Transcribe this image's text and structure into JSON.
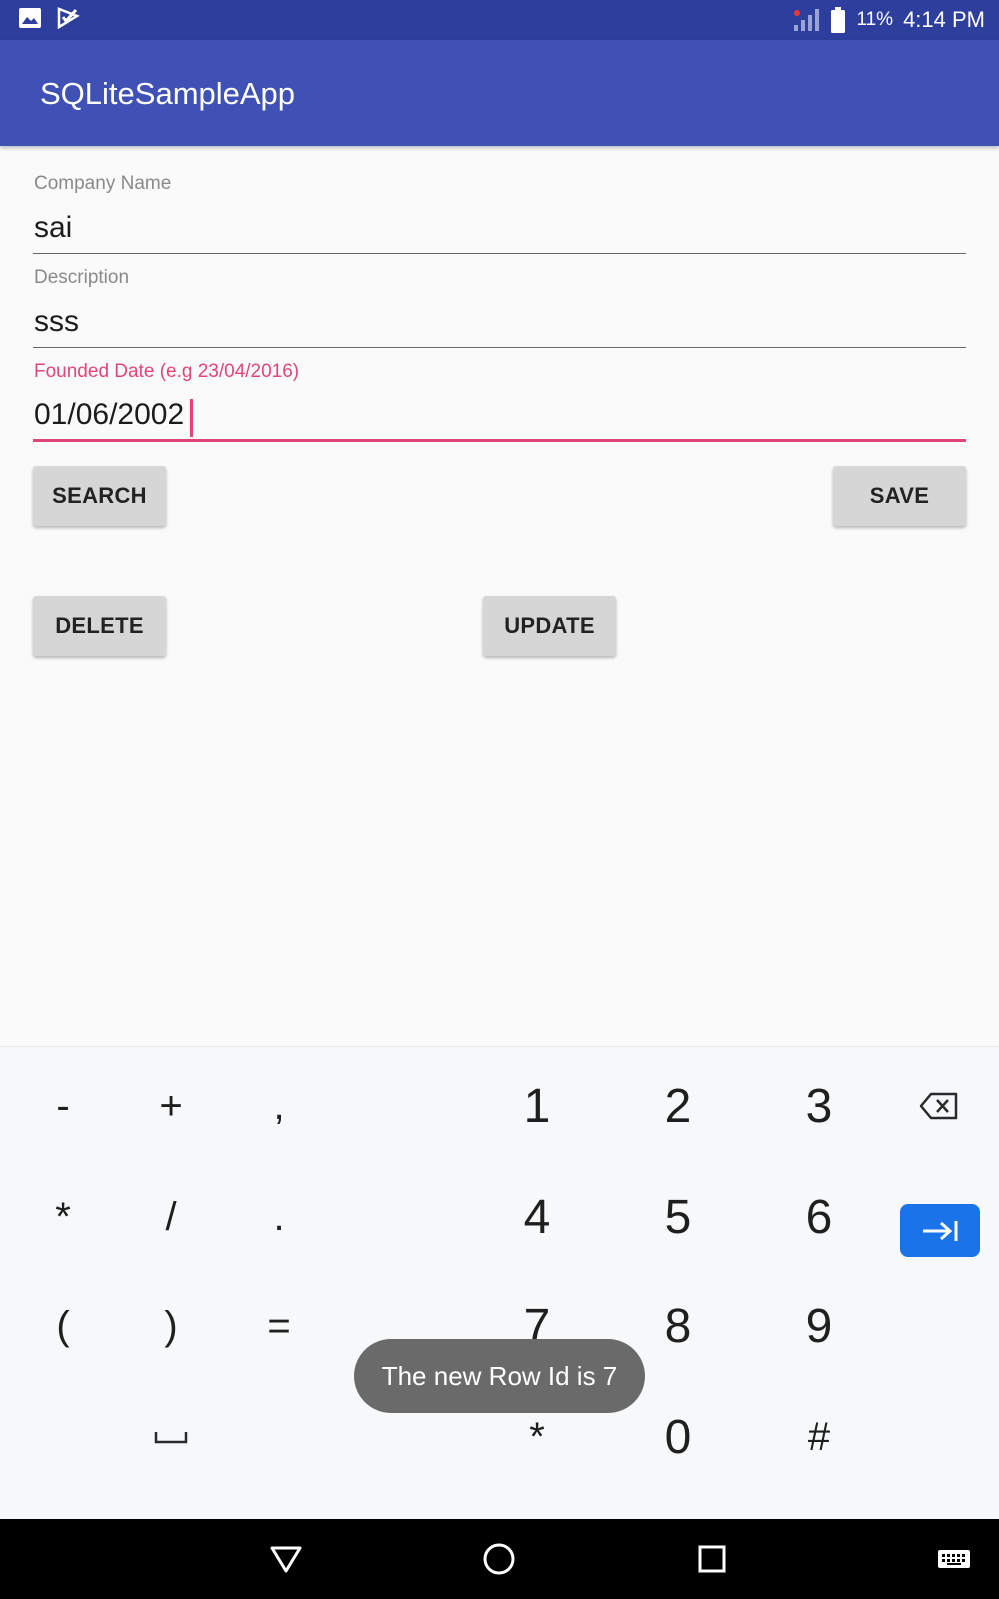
{
  "status_bar": {
    "battery": "11%",
    "time": "4:14 PM",
    "icons": [
      "gallery-icon",
      "check-app-icon",
      "signal-icon",
      "battery-icon"
    ]
  },
  "app_bar": {
    "title": "SQLiteSampleApp",
    "color": "#3f51b5"
  },
  "form": {
    "company_label": "Company Name",
    "company_value": "sai",
    "description_label": "Description",
    "description_value": "sss",
    "date_label": "Founded Date (e.g 23/04/2016)",
    "date_value": "01/06/2002",
    "accent_color": "#e0457b"
  },
  "buttons": {
    "search": "SEARCH",
    "save": "SAVE",
    "delete": "DELETE",
    "update": "UPDATE"
  },
  "keyboard": {
    "row1": [
      "-",
      "+",
      ",",
      "1",
      "2",
      "3"
    ],
    "row2": [
      "*",
      "/",
      ".",
      "4",
      "5",
      "6"
    ],
    "row3": [
      "(",
      ")",
      "=",
      "7",
      "8",
      "9"
    ],
    "row4": [
      "*",
      "0",
      "#"
    ],
    "space_symbol": "␣",
    "icons": [
      "backspace-icon",
      "next-field-icon",
      "space-icon"
    ],
    "action_color": "#1a73e8"
  },
  "toast": {
    "message": "The new Row Id is 7"
  },
  "nav_bar": {
    "icons": [
      "back-icon",
      "home-icon",
      "recents-icon",
      "keyboard-icon"
    ]
  }
}
